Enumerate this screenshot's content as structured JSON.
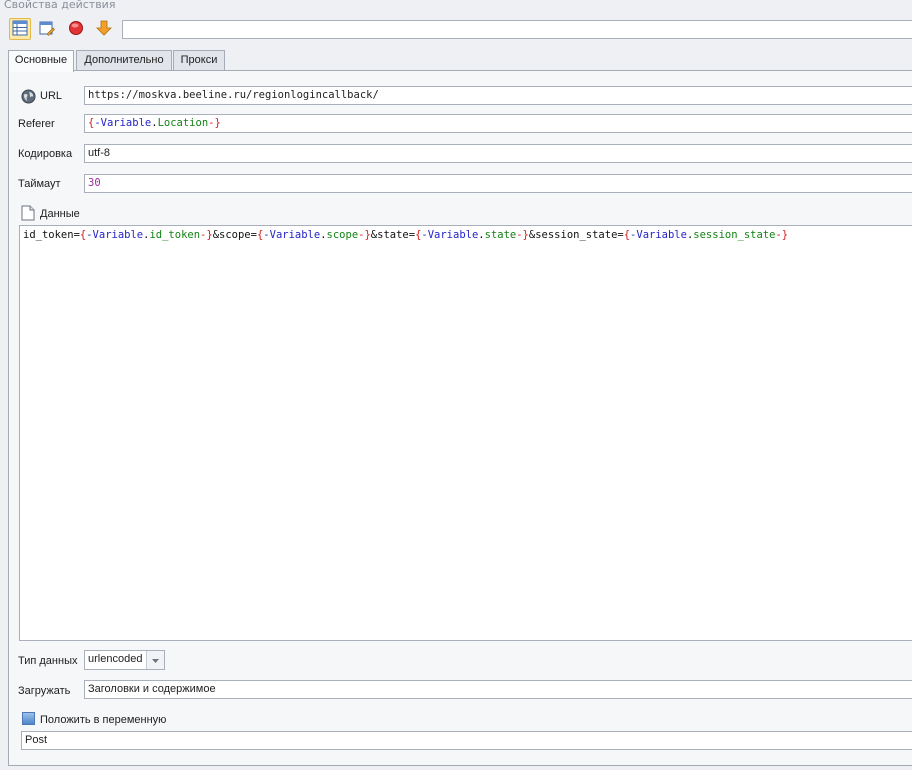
{
  "panel": {
    "title": "Свойства действия"
  },
  "toolbar": {
    "buttons": [
      {
        "icon": "grid-view-icon"
      },
      {
        "icon": "edit-icon"
      },
      {
        "icon": "stop-icon"
      },
      {
        "icon": "arrow-down-icon"
      }
    ],
    "input_value": ""
  },
  "tabs": [
    {
      "label": "Основные",
      "active": true
    },
    {
      "label": "Дополнительно",
      "active": false
    },
    {
      "label": "Прокси",
      "active": false
    }
  ],
  "fields": {
    "url": {
      "label": "URL",
      "value": "https://moskva.beeline.ru/regionlogincallback/"
    },
    "referer": {
      "label": "Referer",
      "open": "{",
      "keyword": "-Variable",
      "dot": ".",
      "name": "Location",
      "close": "-}"
    },
    "encoding": {
      "label": "Кодировка",
      "value": "utf-8"
    },
    "timeout": {
      "label": "Таймаут",
      "value": "30"
    }
  },
  "data_section": {
    "label": "Данные",
    "content": [
      {
        "text": "id_token=",
        "kind": "plain"
      },
      {
        "text": "{",
        "kind": "brace"
      },
      {
        "text": "-Variable",
        "kind": "vkw"
      },
      {
        "text": ".",
        "kind": "vdot"
      },
      {
        "text": "id_token",
        "kind": "vname"
      },
      {
        "text": "-}",
        "kind": "brace"
      },
      {
        "text": "&scope=",
        "kind": "plain"
      },
      {
        "text": "{",
        "kind": "brace"
      },
      {
        "text": "-Variable",
        "kind": "vkw"
      },
      {
        "text": ".",
        "kind": "vdot"
      },
      {
        "text": "scope",
        "kind": "vname"
      },
      {
        "text": "-}",
        "kind": "brace"
      },
      {
        "text": "&state=",
        "kind": "plain"
      },
      {
        "text": "{",
        "kind": "brace"
      },
      {
        "text": "-Variable",
        "kind": "vkw"
      },
      {
        "text": ".",
        "kind": "vdot"
      },
      {
        "text": "state",
        "kind": "vname"
      },
      {
        "text": "-}",
        "kind": "brace"
      },
      {
        "text": "&session_state=",
        "kind": "plain"
      },
      {
        "text": "{",
        "kind": "brace"
      },
      {
        "text": "-Variable",
        "kind": "vkw"
      },
      {
        "text": ".",
        "kind": "vdot"
      },
      {
        "text": "session_state",
        "kind": "vname"
      },
      {
        "text": "-}",
        "kind": "brace"
      }
    ]
  },
  "data_type": {
    "label": "Тип данных",
    "value": "urlencoded"
  },
  "load": {
    "label": "Загружать",
    "value": "Заголовки и содержимое"
  },
  "save_to_variable": {
    "label": "Положить в переменную",
    "value": "Post"
  },
  "colors": {
    "brace": "#d01c1c",
    "keyword": "#2323c8",
    "variable_name": "#148214",
    "number": "#9c2c9c"
  }
}
